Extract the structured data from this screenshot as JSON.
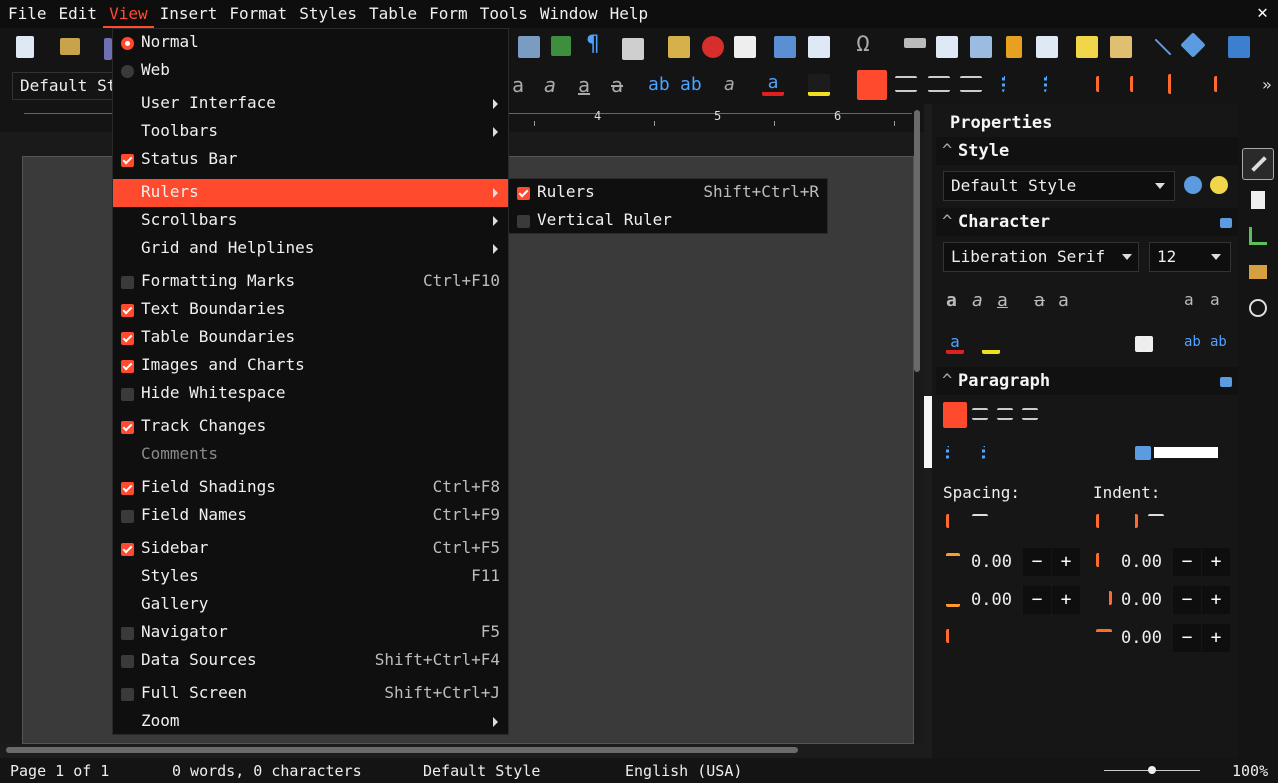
{
  "menubar": {
    "items": [
      "File",
      "Edit",
      "View",
      "Insert",
      "Format",
      "Styles",
      "Table",
      "Form",
      "Tools",
      "Window",
      "Help"
    ],
    "active": "View",
    "close_glyph": "✕"
  },
  "toolbar": {
    "paragraph_style": "Default Style",
    "accent_color": "#ff4a2e"
  },
  "ruler": {
    "numbers": [
      "4",
      "5",
      "6"
    ]
  },
  "view_menu": {
    "items": [
      {
        "label": "Normal",
        "kind": "radio",
        "checked": true
      },
      {
        "label": "Web",
        "kind": "radio",
        "checked": false
      },
      {
        "label": "User Interface",
        "kind": "submenu"
      },
      {
        "label": "Toolbars",
        "kind": "submenu"
      },
      {
        "label": "Status Bar",
        "kind": "check",
        "checked": true
      },
      {
        "label": "Rulers",
        "kind": "submenu",
        "highlighted": true
      },
      {
        "label": "Scrollbars",
        "kind": "submenu"
      },
      {
        "label": "Grid and Helplines",
        "kind": "submenu"
      },
      {
        "label": "Formatting Marks",
        "kind": "check",
        "checked": false,
        "shortcut": "Ctrl+F10"
      },
      {
        "label": "Text Boundaries",
        "kind": "check",
        "checked": true
      },
      {
        "label": "Table Boundaries",
        "kind": "check",
        "checked": true
      },
      {
        "label": "Images and Charts",
        "kind": "check",
        "checked": true
      },
      {
        "label": "Hide Whitespace",
        "kind": "check",
        "checked": false
      },
      {
        "label": "Track Changes",
        "kind": "check",
        "checked": true
      },
      {
        "label": "Comments",
        "kind": "plain",
        "disabled": true
      },
      {
        "label": "Field Shadings",
        "kind": "check",
        "checked": true,
        "shortcut": "Ctrl+F8"
      },
      {
        "label": "Field Names",
        "kind": "check",
        "checked": false,
        "shortcut": "Ctrl+F9"
      },
      {
        "label": "Sidebar",
        "kind": "check",
        "checked": true,
        "shortcut": "Ctrl+F5"
      },
      {
        "label": "Styles",
        "kind": "plain",
        "shortcut": "F11"
      },
      {
        "label": "Gallery",
        "kind": "plain"
      },
      {
        "label": "Navigator",
        "kind": "check",
        "checked": false,
        "shortcut": "F5"
      },
      {
        "label": "Data Sources",
        "kind": "check",
        "checked": false,
        "shortcut": "Shift+Ctrl+F4"
      },
      {
        "label": "Full Screen",
        "kind": "check",
        "checked": false,
        "shortcut": "Shift+Ctrl+J"
      },
      {
        "label": "Zoom",
        "kind": "submenu"
      }
    ]
  },
  "rulers_submenu": {
    "items": [
      {
        "label": "Rulers",
        "checked": true,
        "shortcut": "Shift+Ctrl+R"
      },
      {
        "label": "Vertical Ruler",
        "checked": false
      }
    ]
  },
  "sidebar": {
    "title": "Properties",
    "style_section": {
      "header": "Style",
      "value": "Default Style"
    },
    "character_section": {
      "header": "Character",
      "font": "Liberation Serif",
      "size": "12"
    },
    "paragraph_section": {
      "header": "Paragraph",
      "spacing_label": "Spacing:",
      "indent_label": "Indent:",
      "above_spacing": "0.00",
      "below_spacing": "0.00",
      "before_indent": "0.00",
      "after_indent": "0.00",
      "first_line_indent": "0.00"
    }
  },
  "statusbar": {
    "page": "Page 1 of 1",
    "words": "0 words, 0 characters",
    "style": "Default Style",
    "language": "English (USA)",
    "zoom": "100%"
  }
}
